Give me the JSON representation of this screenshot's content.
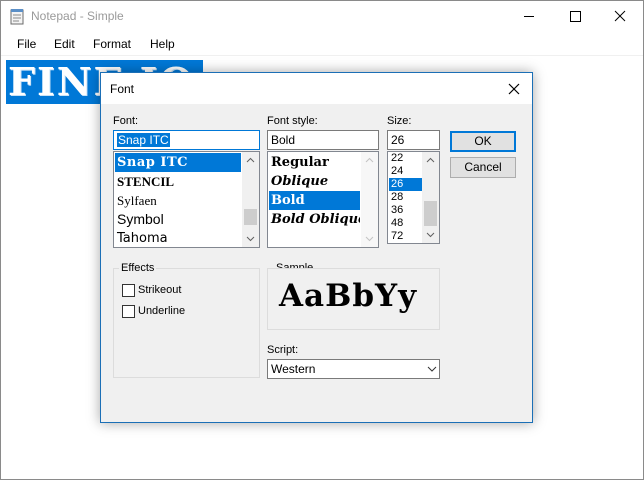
{
  "notepad": {
    "title": "Notepad - Simple",
    "menu": [
      "File",
      "Edit",
      "Format",
      "Help"
    ],
    "document_text": "FINE IO"
  },
  "dialog": {
    "title": "Font",
    "font": {
      "label": "Font:",
      "value": "Snap ITC",
      "items": [
        "Snap ITC",
        "STENCIL",
        "Sylfaen",
        "Symbol",
        "Tahoma"
      ],
      "selected": "Snap ITC"
    },
    "style": {
      "label": "Font style:",
      "value": "Bold",
      "items": [
        "Regular",
        "Oblique",
        "Bold",
        "Bold Oblique"
      ],
      "selected": "Bold"
    },
    "size": {
      "label": "Size:",
      "value": "26",
      "items": [
        "22",
        "24",
        "26",
        "28",
        "36",
        "48",
        "72"
      ],
      "selected": "26"
    },
    "buttons": {
      "ok": "OK",
      "cancel": "Cancel"
    },
    "effects": {
      "label": "Effects",
      "strikeout": "Strikeout",
      "underline": "Underline",
      "strikeout_checked": false,
      "underline_checked": false
    },
    "sample": {
      "label": "Sample",
      "text": "AaBbYy"
    },
    "script": {
      "label": "Script:",
      "value": "Western"
    }
  },
  "colors": {
    "selection": "#0078d7",
    "dialog_bg": "#f0f0f0",
    "dialog_border": "#1b6fb6"
  }
}
